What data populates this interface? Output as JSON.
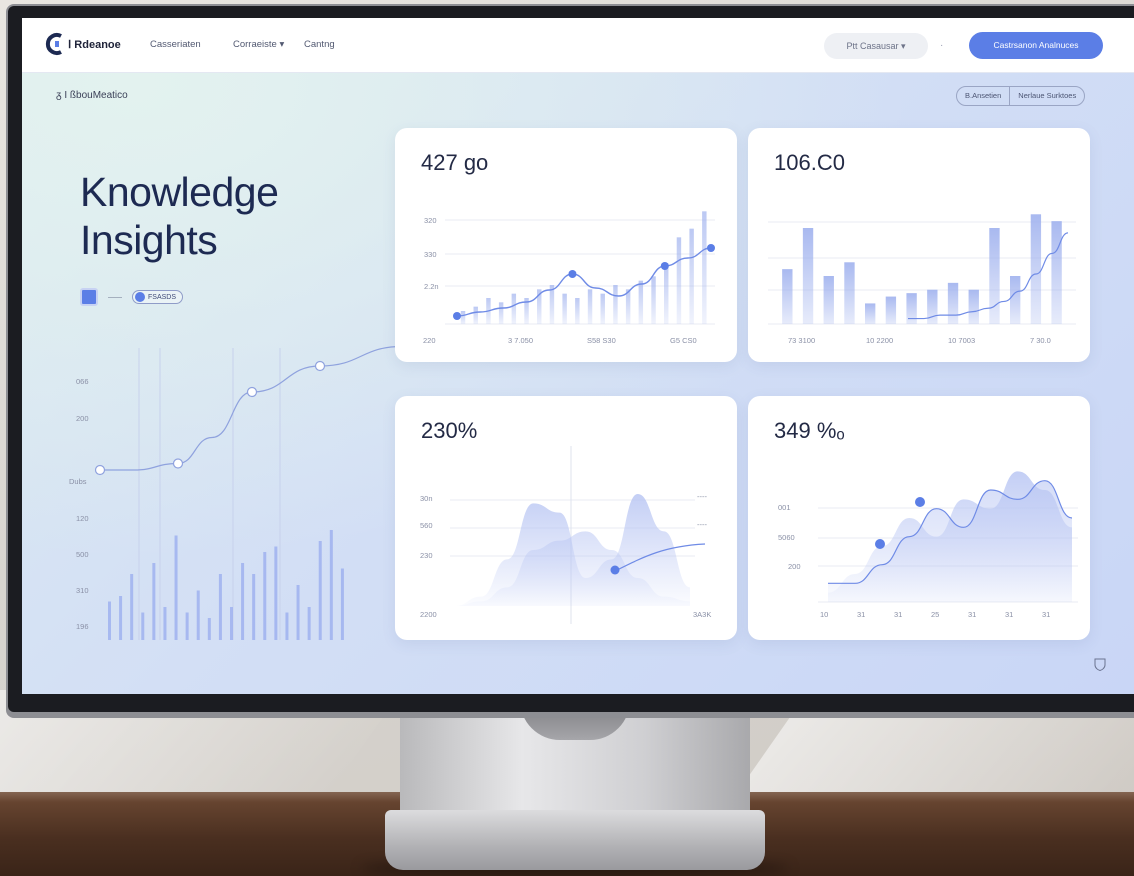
{
  "topbar": {
    "brand": "Ⅰ Rdeanoe",
    "nav": [
      "Casseriaten",
      "Corraeiste ▾",
      "Cantng"
    ],
    "search_label": "Ptt Casausar ▾",
    "separator": "·",
    "cta_label": "Castrsanon  Analnuces"
  },
  "breadcrumb": "ᵹ I ßbouMeatico",
  "segment": [
    "B.Ansetien",
    "Nerlaue Surktoes"
  ],
  "hero": {
    "title_line1": "Knowledge",
    "title_line2": "Insights",
    "dash_text": "——",
    "chip_label": "FSASDS"
  },
  "left_chart": {
    "y_ticks": [
      "066",
      "200",
      "Dubs",
      "120",
      "500",
      "310",
      "196"
    ]
  },
  "cards": {
    "c1": {
      "title": "427 go",
      "y_ticks": [
        "320",
        "330",
        "2.2n"
      ],
      "x_ticks": [
        "220",
        "3 7.050",
        "S58 S30",
        "G5 CS0"
      ]
    },
    "c2": {
      "title": "106.C0",
      "x_ticks": [
        "73 3100",
        "10 2200",
        "10 7003",
        "7 30.0"
      ]
    },
    "c3": {
      "title": "230%",
      "y_ticks": [
        "30n",
        "560",
        "230"
      ],
      "x_ticks": [
        "2200",
        "3A3K"
      ],
      "side_ticks": [
        "----",
        "----"
      ]
    },
    "c4": {
      "title": "349 %ₒ",
      "y_ticks": [
        "001",
        "5060",
        "200"
      ],
      "x_ticks": [
        "10",
        "31",
        "31",
        "25",
        "31",
        "31",
        "31"
      ]
    }
  },
  "colors": {
    "accent": "#5b7ee6",
    "bar": "#9fb1ee",
    "line": "#6f8be6",
    "area": "#b9c6f3"
  },
  "chart_data": [
    {
      "type": "bar",
      "title": "427 go",
      "values": [
        3,
        4,
        6,
        5,
        7,
        6,
        8,
        9,
        7,
        6,
        8,
        7,
        9,
        8,
        10,
        11,
        14,
        20,
        22,
        26
      ],
      "series": [
        {
          "values": [
            2.0,
            2.4,
            2.8,
            3.4,
            4.6,
            6.2,
            4.8,
            4.0,
            5.2,
            7.0,
            7.8,
            8.8
          ]
        }
      ],
      "ylim": [
        0,
        30
      ]
    },
    {
      "type": "bar",
      "title": "106.C0",
      "values": [
        16,
        28,
        14,
        18,
        6,
        8,
        9,
        10,
        12,
        10,
        28,
        14,
        32,
        30
      ],
      "series": [
        {
          "values": [
            1,
            1,
            2,
            2,
            3,
            4,
            6,
            9,
            14,
            20,
            26
          ]
        }
      ],
      "ylim": [
        0,
        35
      ]
    },
    {
      "type": "area",
      "title": "230%",
      "series": [
        {
          "values": [
            0,
            2,
            10,
            22,
            20,
            6,
            10,
            24,
            16,
            4
          ]
        },
        {
          "values": [
            0,
            1,
            4,
            12,
            14,
            16,
            12,
            6,
            2,
            1
          ]
        }
      ],
      "ylim": [
        0,
        30
      ]
    },
    {
      "type": "area",
      "title": "349 %ₒ",
      "series": [
        {
          "values": [
            2,
            6,
            12,
            18,
            14,
            22,
            20,
            28,
            24,
            16
          ]
        },
        {
          "values": [
            4,
            4,
            8,
            14,
            20,
            16,
            24,
            22,
            26,
            18
          ]
        }
      ],
      "ylim": [
        0,
        30
      ]
    },
    {
      "type": "line",
      "series": [
        {
          "values": [
            14,
            14,
            15,
            19,
            26,
            30,
            33
          ]
        }
      ],
      "bars": [
        7,
        8,
        12,
        5,
        14,
        6,
        19,
        5,
        9,
        4,
        12,
        6,
        14,
        12,
        16,
        17,
        5,
        10,
        6,
        18,
        20,
        13
      ]
    }
  ]
}
